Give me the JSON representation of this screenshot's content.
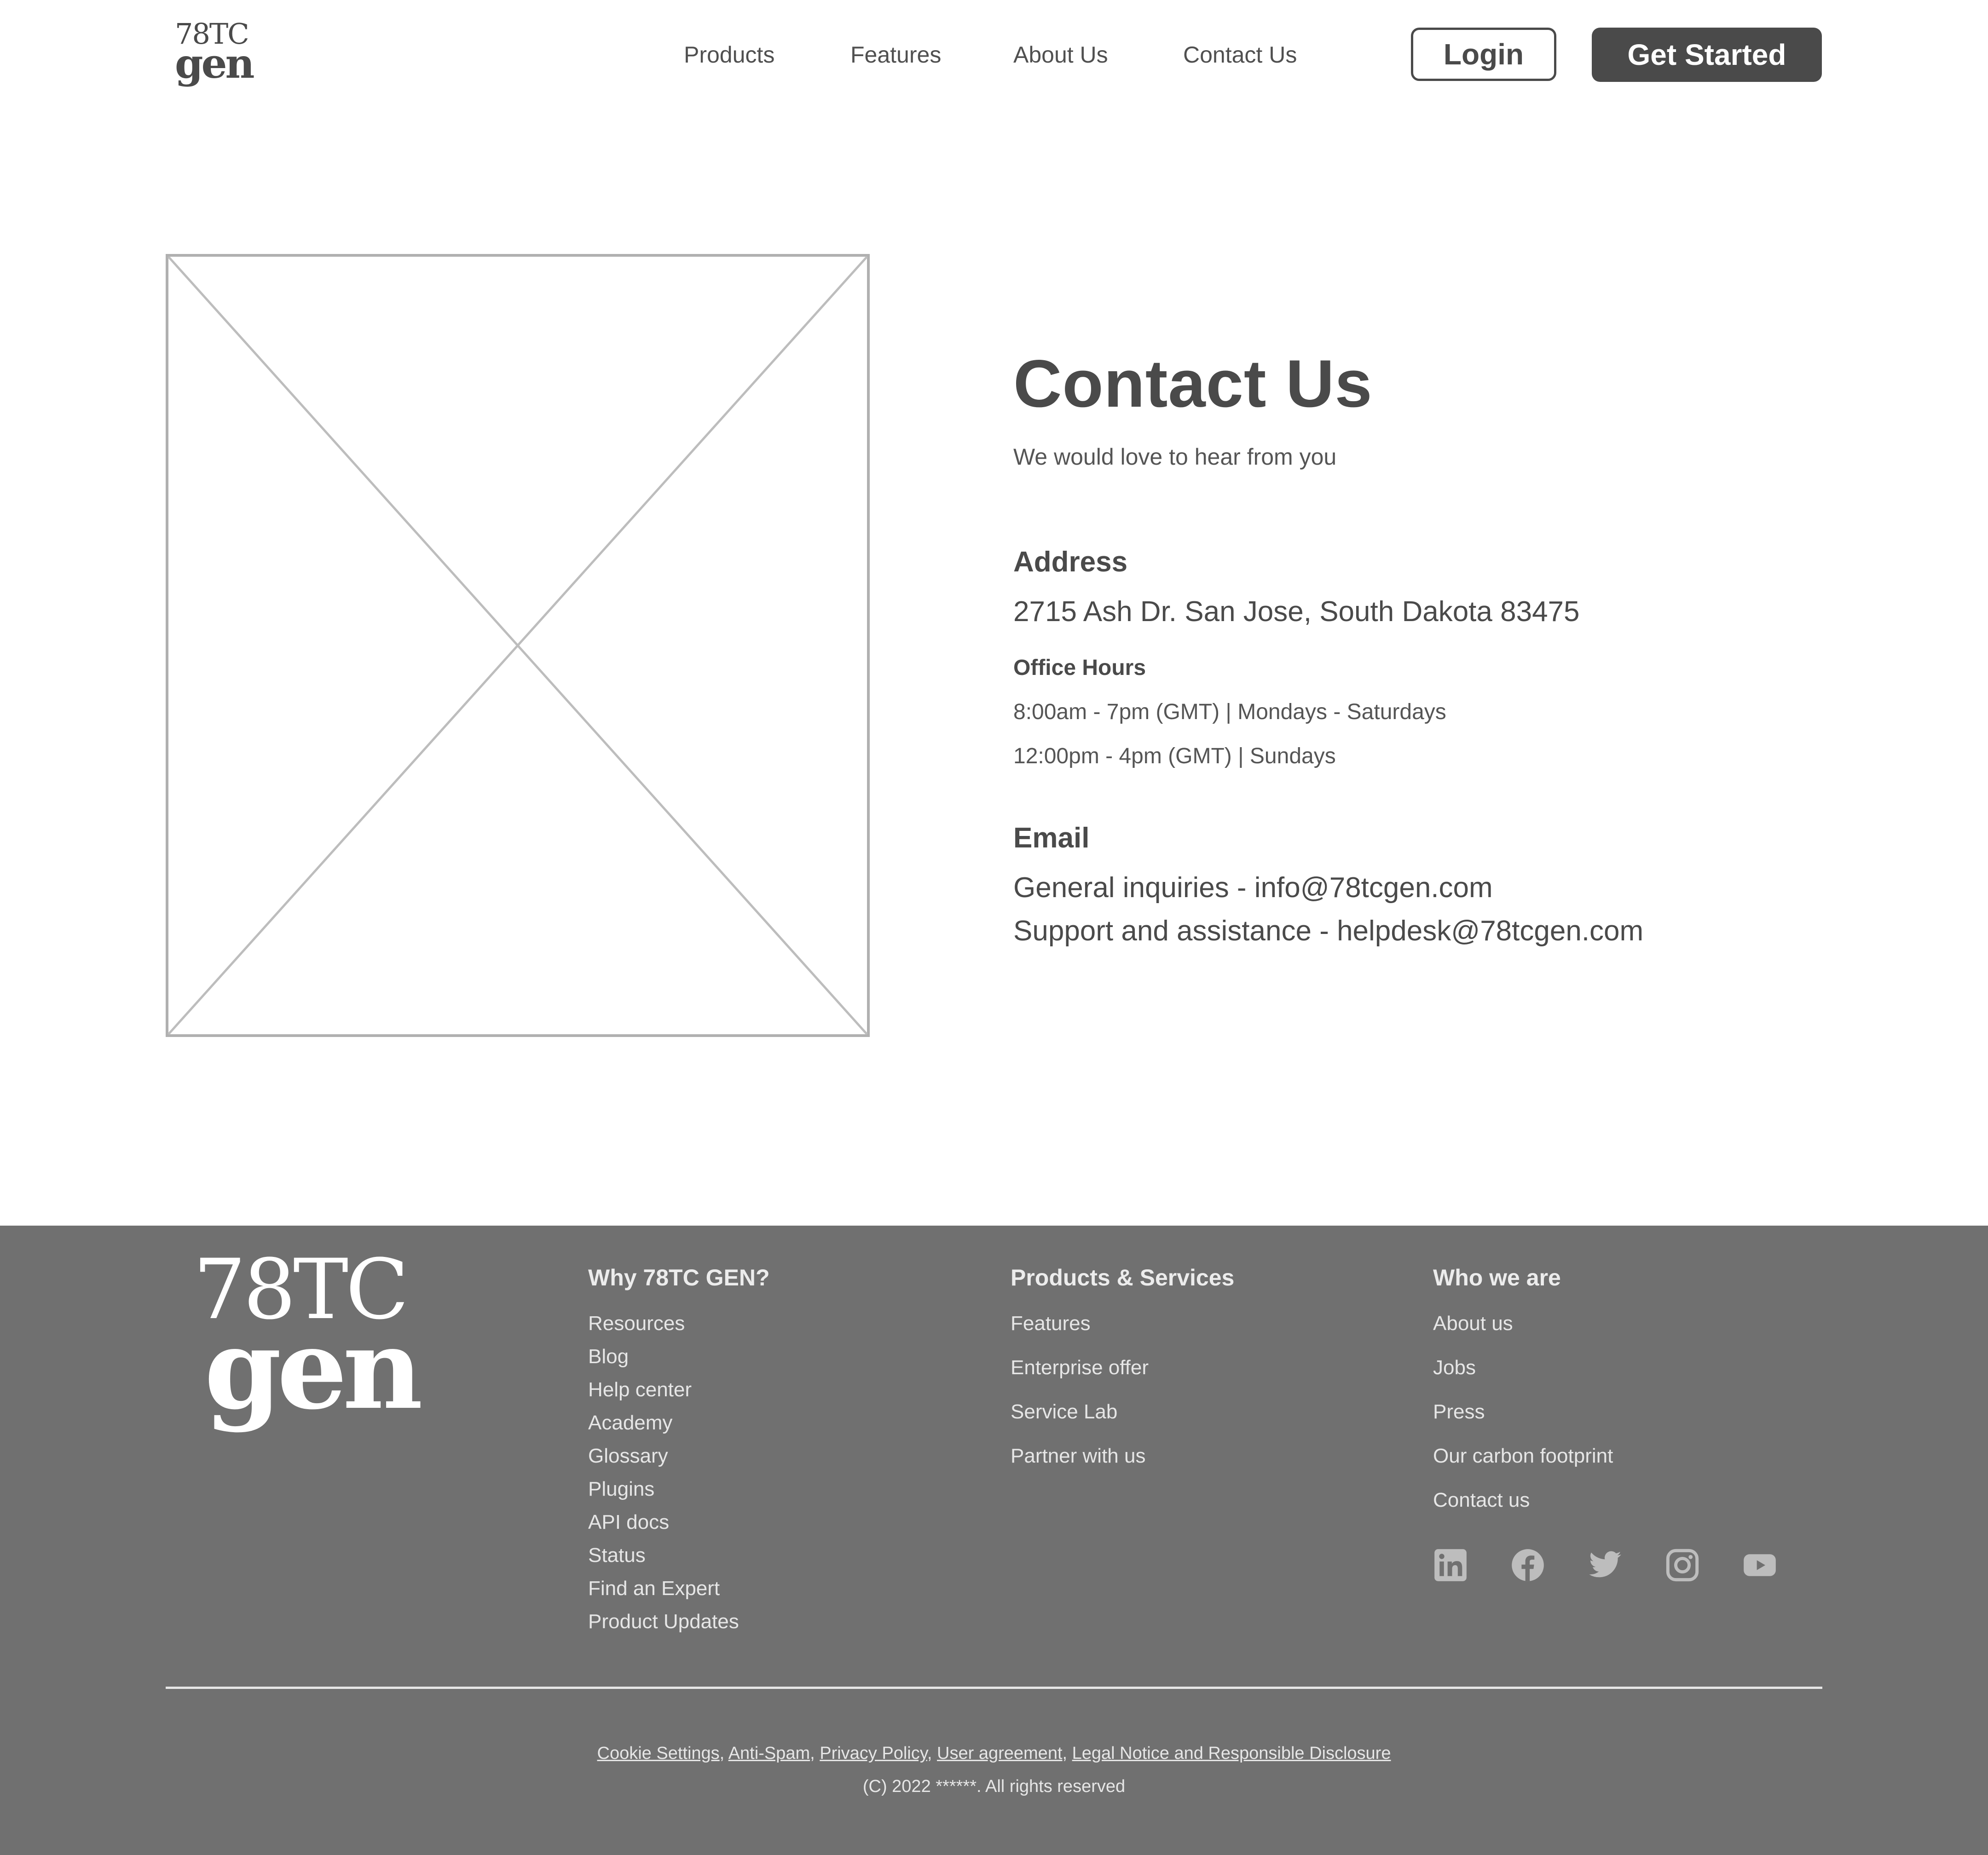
{
  "header": {
    "logo_line1": "78TC",
    "logo_line2": "gen",
    "nav": [
      "Products",
      "Features",
      "About Us",
      "Contact Us"
    ],
    "login_label": "Login",
    "get_started_label": "Get Started"
  },
  "contact": {
    "title": "Contact Us",
    "subtitle": "We would love to hear from you",
    "address_heading": "Address",
    "address": "2715 Ash Dr. San Jose, South Dakota 83475",
    "office_hours_heading": "Office Hours",
    "hours": [
      "8:00am - 7pm (GMT) | Mondays - Saturdays",
      "12:00pm - 4pm (GMT) | Sundays"
    ],
    "email_heading": "Email",
    "emails": [
      "General inquiries - info@78tcgen.com",
      "Support and assistance - helpdesk@78tcgen.com"
    ]
  },
  "footer": {
    "logo_line1": "78TC",
    "logo_line2": "gen",
    "columns": [
      {
        "heading": "Why 78TC GEN?",
        "links": [
          "Resources",
          "Blog",
          "Help center",
          "Academy",
          "Glossary",
          "Plugins",
          "API docs",
          "Status",
          "Find an Expert",
          "Product Updates"
        ]
      },
      {
        "heading": "Products & Services",
        "links": [
          "Features",
          "Enterprise offer",
          "Service Lab",
          "Partner with us"
        ]
      },
      {
        "heading": "Who we are",
        "links": [
          "About us",
          "Jobs",
          "Press",
          "Our carbon footprint",
          "Contact us"
        ]
      }
    ],
    "social_icons": [
      "linkedin-icon",
      "facebook-icon",
      "twitter-icon",
      "instagram-icon",
      "youtube-icon"
    ],
    "legal_links": [
      "Cookie Settings",
      "Anti-Spam",
      "Privacy Policy",
      "User agreement",
      "Legal Notice and Responsible Disclosure"
    ],
    "legal_separator": ", ",
    "copyright": "(C) 2022 ******. All rights reserved"
  },
  "colors": {
    "text_dark": "#4a4a4a",
    "footer_bg": "#707070",
    "footer_text": "#e6e6e6",
    "placeholder_stroke": "#bdbdbd"
  }
}
